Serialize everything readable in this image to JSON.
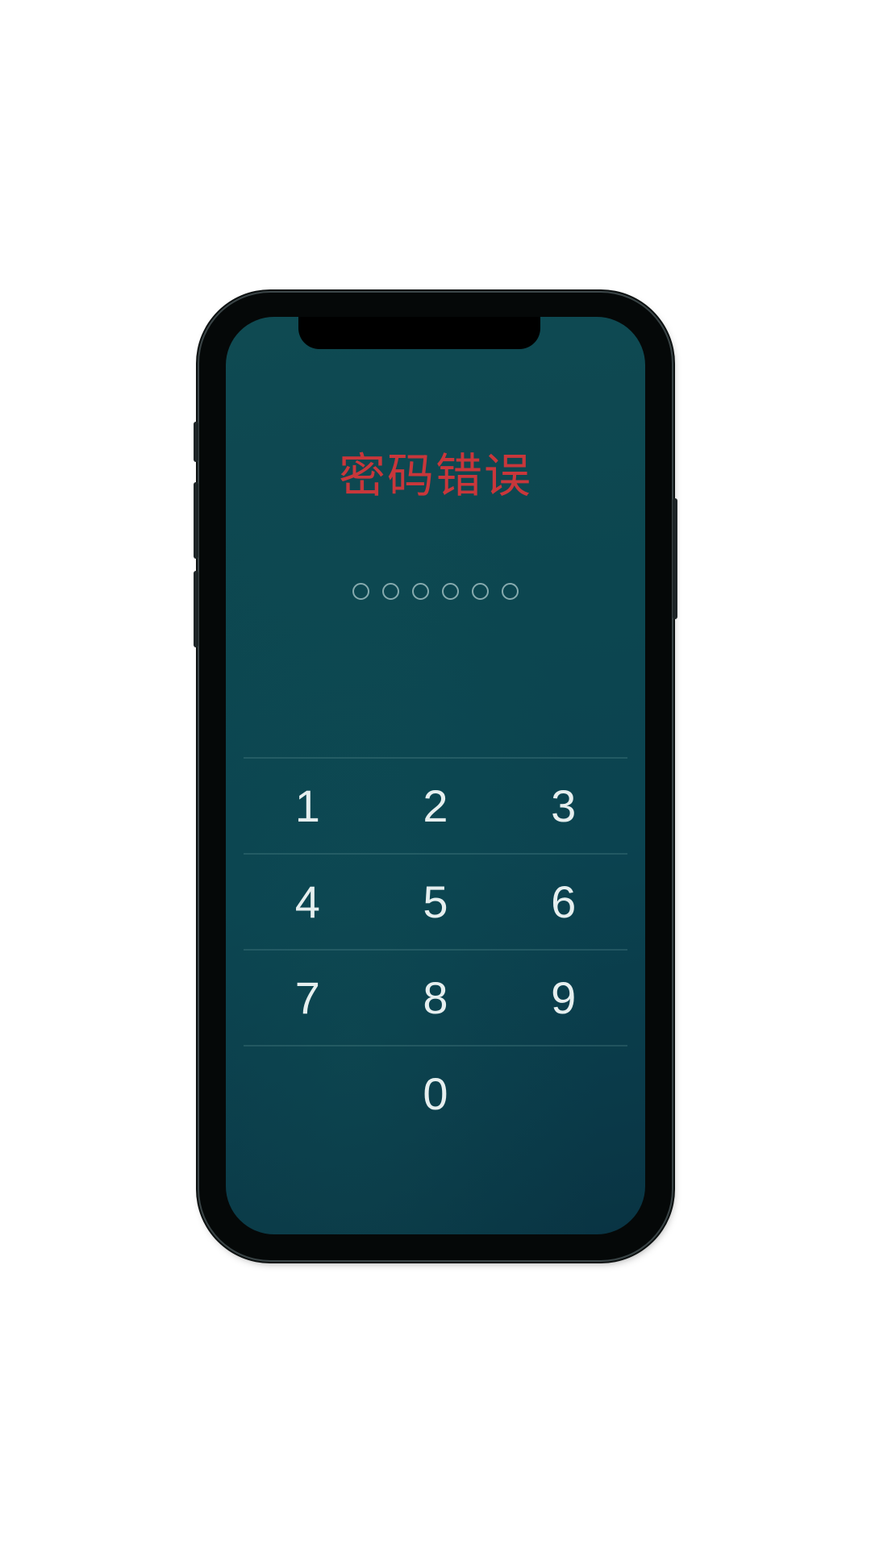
{
  "screen": {
    "error_title": "密码错误",
    "passcode_length": 6,
    "passcode_filled": 0
  },
  "keypad": {
    "rows": [
      [
        "1",
        "2",
        "3"
      ],
      [
        "4",
        "5",
        "6"
      ],
      [
        "7",
        "8",
        "9"
      ],
      [
        "",
        "0",
        ""
      ]
    ]
  },
  "colors": {
    "screen_background": "#0c4650",
    "error_text": "#c8373b",
    "key_text": "#e6efef",
    "phone_frame": "#050808"
  }
}
